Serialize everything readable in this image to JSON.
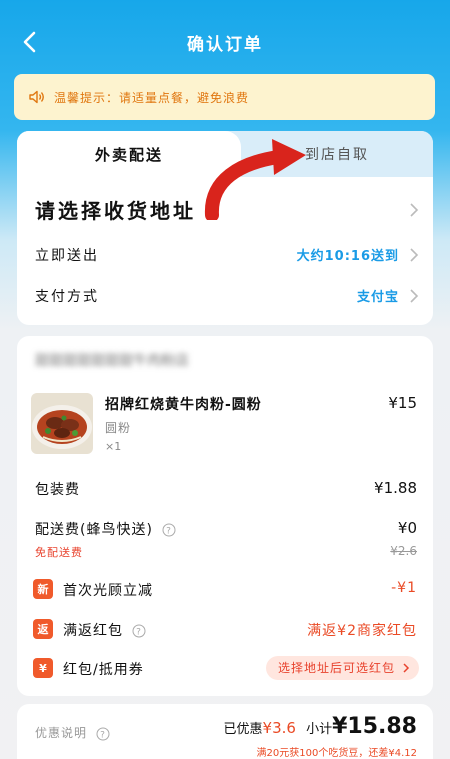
{
  "header": {
    "title": "确认订单",
    "back_icon": "chevron-left-icon"
  },
  "notice": {
    "icon": "speaker-icon",
    "text": "温馨提示：请适量点餐，避免浪费",
    "color": "#e0760f"
  },
  "tabs": [
    {
      "label": "外卖配送",
      "active": true
    },
    {
      "label": "到店自取",
      "active": false
    }
  ],
  "address": {
    "label": "请选择收货地址"
  },
  "delivery_time": {
    "label": "立即送出",
    "value": "大约10:16送到"
  },
  "payment": {
    "label": "支付方式",
    "value": "支付宝"
  },
  "shop": {
    "name": "甜甜甜甜甜甜甜牛肉粉店"
  },
  "item": {
    "name": "招牌红烧黄牛肉粉-圆粉",
    "spec": "圆粉",
    "qty": "×1",
    "price": "¥15"
  },
  "packaging": {
    "label": "包装费",
    "value": "¥1.88"
  },
  "delivery_fee": {
    "label": "配送费(蜂鸟快送)",
    "value": "¥0",
    "free_label": "免配送费",
    "original": "¥2.6"
  },
  "promos": [
    {
      "badge": "新",
      "label": "首次光顾立减",
      "value": "-¥1"
    },
    {
      "badge": "返",
      "label": "满返红包",
      "value": "满返¥2商家红包"
    },
    {
      "badge": "¥",
      "label": "红包/抵用券",
      "value": "选择地址后可选红包"
    }
  ],
  "summary": {
    "note_label": "优惠说明",
    "saved_label": "已优惠",
    "saved_value": "¥3.6",
    "subtotal_label": "小计",
    "subtotal_value": "¥15.88",
    "sub_note": "满20元获100个吃货豆，还差¥4.12"
  },
  "colors": {
    "accent_blue": "#1a9be6",
    "promo_red": "#ea4a25",
    "header_blue": "#17a7ea"
  }
}
